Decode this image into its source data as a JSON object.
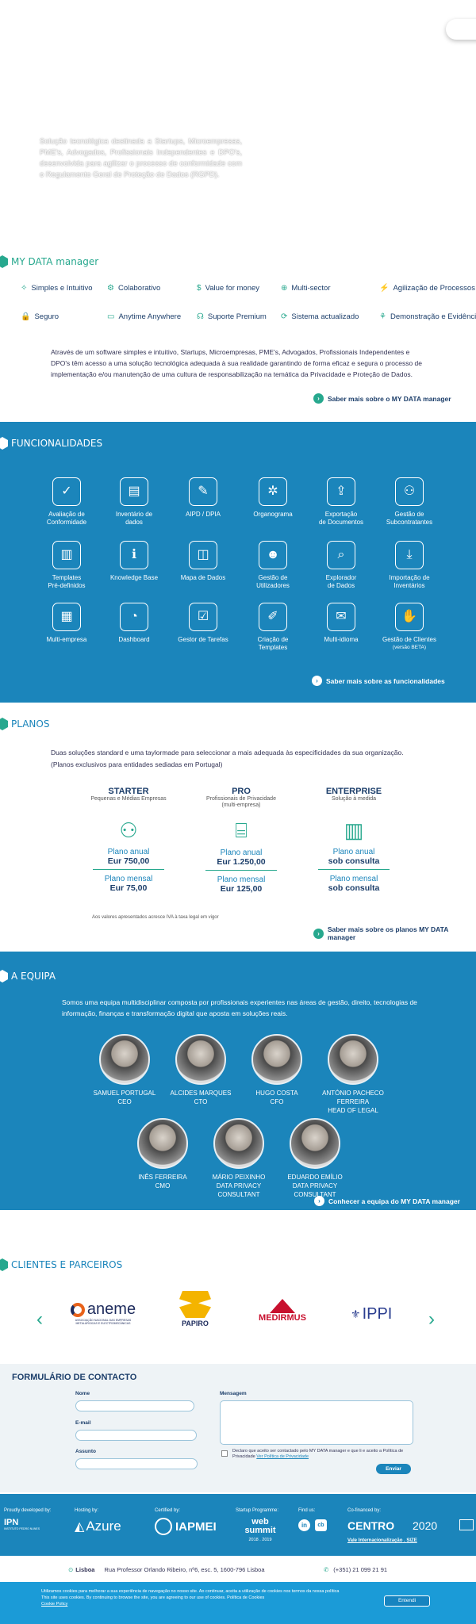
{
  "hero": {
    "text": "Solução tecnológica destinada a Startups, Microempresas, PME's, Advogados, Profissionais Independentes e DPO's, desenvolvida para agilizar o processo de conformidade com o Regulamento Geral de Proteção de Dados (RGPD)."
  },
  "mdm": {
    "title": "MY DATA manager",
    "features": [
      {
        "icon": "bulb-icon",
        "glyph": "✧",
        "label": "Simples e Intuitivo"
      },
      {
        "icon": "team-icon",
        "glyph": "⚙",
        "label": "Colaborativo"
      },
      {
        "icon": "money-icon",
        "glyph": "$",
        "label": "Value for money"
      },
      {
        "icon": "globe-icon",
        "glyph": "⊕",
        "label": "Multi-sector"
      },
      {
        "icon": "process-icon",
        "glyph": "⚡",
        "label": "Agilização de Processos"
      },
      {
        "icon": "lock-icon",
        "glyph": "🔒",
        "label": "Seguro"
      },
      {
        "icon": "laptop-icon",
        "glyph": "▭",
        "label": "Anytime Anywhere"
      },
      {
        "icon": "headset-icon",
        "glyph": "☊",
        "label": "Suporte Premium"
      },
      {
        "icon": "refresh-icon",
        "glyph": "⟳",
        "label": "Sistema actualizado"
      },
      {
        "icon": "network-icon",
        "glyph": "⚘",
        "label": "Demonstração e Evidência"
      }
    ],
    "paragraph": "Através de um software simples e intuitivo, Startups, Microempresas, PME's, Advogados, Profissionais Independentes e DPO's têm acesso a uma solução tecnológica adequada à sua realidade garantindo de forma eficaz e segura o processo de implementação e/ou manutenção de uma cultura de responsabilização na temática da Privacidade e Proteção de Dados.",
    "more": "Saber mais sobre o MY DATA manager"
  },
  "func": {
    "title": "FUNCIONALIDADES",
    "tiles": [
      {
        "l1": "Avaliação de",
        "l2": "Conformidade",
        "g": "✓"
      },
      {
        "l1": "Inventário de",
        "l2": "dados",
        "g": "▤"
      },
      {
        "l1": "AIPD / DPIA",
        "l2": "",
        "g": "✎"
      },
      {
        "l1": "Organograma",
        "l2": "",
        "g": "✲"
      },
      {
        "l1": "Exportação",
        "l2": "de Documentos",
        "g": "⇪"
      },
      {
        "l1": "Gestão de",
        "l2": "Subcontratantes",
        "g": "⚇"
      },
      {
        "l1": "Templates",
        "l2": "Pré-definidos",
        "g": "▥"
      },
      {
        "l1": "Knowledge Base",
        "l2": "",
        "g": "ℹ"
      },
      {
        "l1": "Mapa de Dados",
        "l2": "",
        "g": "◫"
      },
      {
        "l1": "Gestão de",
        "l2": "Utilizadores",
        "g": "☻"
      },
      {
        "l1": "Explorador",
        "l2": "de Dados",
        "g": "⌕"
      },
      {
        "l1": "Importação de",
        "l2": "Inventários",
        "g": "⤓"
      },
      {
        "l1": "Multi-empresa",
        "l2": "",
        "g": "▦"
      },
      {
        "l1": "Dashboard",
        "l2": "",
        "g": "◔"
      },
      {
        "l1": "Gestor de Tarefas",
        "l2": "",
        "g": "☑"
      },
      {
        "l1": "Criação de",
        "l2": "Templates",
        "g": "✐"
      },
      {
        "l1": "Multi-idioma",
        "l2": "",
        "g": "✉"
      },
      {
        "l1": "Gestão de Clientes",
        "l2": "(versão BETA)",
        "g": "✋"
      }
    ],
    "more": "Saber mais sobre as funcionalidades"
  },
  "plans": {
    "title": "PLANOS",
    "intro1": "Duas soluções standard e uma taylormade para seleccionar a mais adequada às especificidades da sua organização.",
    "intro2": "(Planos exclusivos para entidades sediadas em Portugal)",
    "items": [
      {
        "name": "STARTER",
        "sub": "Pequenas e Médias Empresas",
        "sub2": "",
        "glyph": "⚇",
        "annual_label": "Plano anual",
        "annual": "Eur 750,00",
        "monthly_label": "Plano mensal",
        "monthly": "Eur 75,00"
      },
      {
        "name": "PRO",
        "sub": "Profissionais de Privacidade",
        "sub2": "(multi-empresa)",
        "glyph": "⌸",
        "annual_label": "Plano anual",
        "annual": "Eur 1.250,00",
        "monthly_label": "Plano mensal",
        "monthly": "Eur 125,00"
      },
      {
        "name": "ENTERPRISE",
        "sub": "Solução à medida",
        "sub2": "",
        "glyph": "▥",
        "annual_label": "Plano anual",
        "annual": "sob consulta",
        "monthly_label": "Plano mensal",
        "monthly": "sob consulta"
      }
    ],
    "note": "Aos valores apresentados acresce IVA à taxa legal em vigor",
    "more": "Saber mais sobre os planos MY DATA manager"
  },
  "team": {
    "title": "A EQUIPA",
    "intro": "Somos uma equipa multidisciplinar composta por profissionais experientes nas áreas de gestão, direito, tecnologias de informação, finanças e transformação digital que aposta em soluções reais.",
    "members": [
      {
        "name": "SAMUEL PORTUGAL",
        "role": "CEO",
        "role2": ""
      },
      {
        "name": "ALCIDES MARQUES",
        "role": "CTO",
        "role2": ""
      },
      {
        "name": "HUGO COSTA",
        "role": "CFO",
        "role2": ""
      },
      {
        "name": "ANTÓNIO PACHECO FERREIRA",
        "role": "HEAD OF LEGAL",
        "role2": ""
      },
      {
        "name": "INÊS FERREIRA",
        "role": "CMO",
        "role2": ""
      },
      {
        "name": "MÁRIO PEIXINHO",
        "role": "DATA PRIVACY",
        "role2": "CONSULTANT"
      },
      {
        "name": "EDUARDO EMÍLIO",
        "role": "DATA PRIVACY",
        "role2": "CONSULTANT"
      }
    ],
    "more": "Conhecer a equipa do MY DATA manager"
  },
  "clients": {
    "title": "CLIENTES E PARCEIROS",
    "logos": [
      "aneme",
      "PAPIRO",
      "MEDIRMUS",
      "IPPI"
    ],
    "aneme_sub": "ASSOCIAÇÃO NACIONAL DAS EMPRESAS METALÚRGICAS E ELECTROMECÂNICAS",
    "prev": "‹",
    "next": "›"
  },
  "form": {
    "title": "FORMULÁRIO DE CONTACTO",
    "name": "Nome",
    "email": "E-mail",
    "subject": "Assunto",
    "message": "Mensagem",
    "consent": "Declaro que aceito ser contactado pelo MY DATA manager e que li e aceito a Política de Privacidade",
    "consent_link": "Ver Política de Privacidade",
    "submit": "Enviar"
  },
  "footer": {
    "developed": "Proudly developed by:",
    "ipn": "IPN",
    "ipn_sub": "INSTITUTO PEDRO NUNES",
    "hosting": "Hosting by:",
    "azure": "Azure",
    "certified": "Certified by:",
    "iapmei": "IAPMEI",
    "startup": "Startup Programme:",
    "websummit": "web summit",
    "years": "2018 . 2019",
    "find": "Find us:",
    "cofinanced": "Co-financed by:",
    "centro": "CENTRO",
    "p2020": "2020",
    "vale": "Vale Internacionalização",
    "size": "SIZE",
    "city": "Lisboa",
    "address": "Rua Professor Orlando Ribeiro, nº6, esc. 5, 1600-796 Lisboa",
    "phone": "(+351) 21 099 21 91"
  },
  "cookie": {
    "pt": "Utilizamos cookies para melhorar a sua experiência de navegação no nosso site. Ao continuar, aceita a utilização de cookies nos termos da nossa política",
    "en": "This site uses cookies. By continuing to browse the site, you are agreeing to our use of cookies. Política de Cookies",
    "link": "Cookie Policy",
    "button": "Entendi"
  }
}
